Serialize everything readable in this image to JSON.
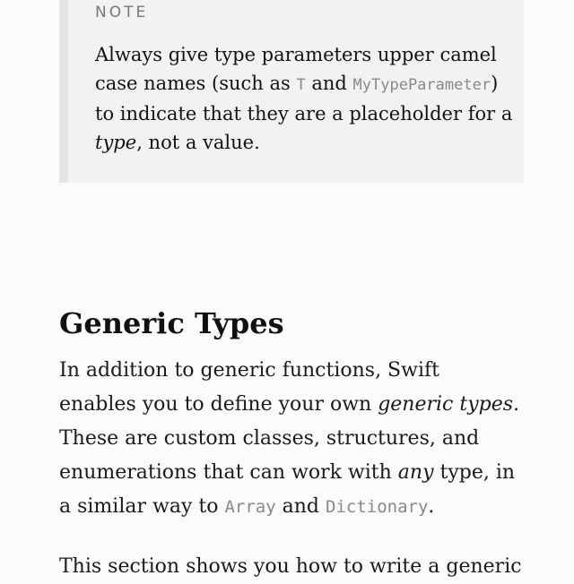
{
  "note": {
    "label": "NOTE",
    "text_1": "Always give type parameters upper camel case names (such as ",
    "code_1": "T",
    "text_2": " and ",
    "code_2": "MyTypeParameter",
    "text_3": ") to indicate that they are a placeholder for a ",
    "em_1": "type",
    "text_4": ", not a value."
  },
  "section": {
    "heading": "Generic Types",
    "para1": {
      "text_1": "In addition to generic functions, Swift enables you to define your own ",
      "em_1": "generic types",
      "text_2": ". These are custom classes, structures, and enumerations that can work with ",
      "em_2": "any",
      "text_3": " type, in a similar way to ",
      "code_1": "Array",
      "text_4": " and ",
      "code_2": "Dictionary",
      "text_5": "."
    },
    "para2": {
      "text": "This section shows you how to write a generic"
    }
  }
}
